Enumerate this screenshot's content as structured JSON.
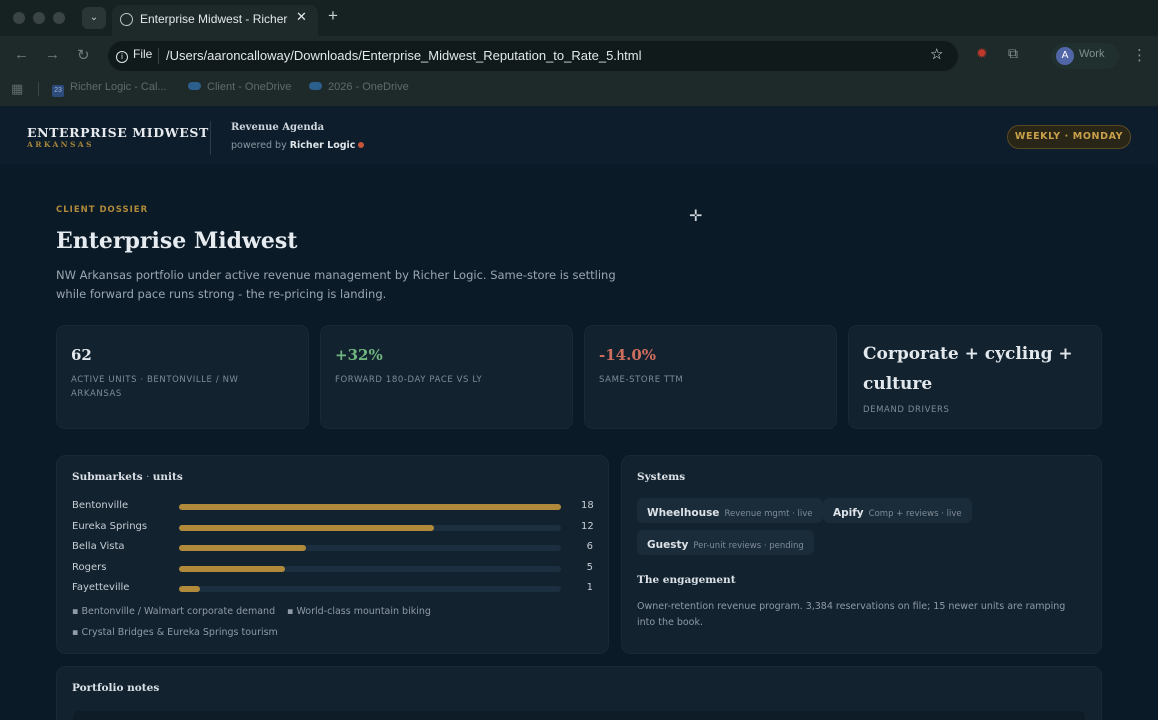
{
  "browser": {
    "tab_title": "Enterprise Midwest - Richer Logic",
    "url_scheme": "File",
    "url": "/Users/aaroncalloway/Downloads/Enterprise_Midwest_Reputation_to_Rate_5.html",
    "profile_initial": "A",
    "profile_label": "Work",
    "bookmarks": [
      {
        "label": "Richer Logic - Cal...",
        "icon": "calendar-icon",
        "icon_text": "23"
      },
      {
        "label": "Client - OneDrive",
        "icon": "onedrive-icon"
      },
      {
        "label": "2026 - OneDrive",
        "icon": "onedrive-icon"
      }
    ]
  },
  "header": {
    "brand_title": "ENTERPRISE MIDWEST",
    "brand_sub": "ARKANSAS",
    "agenda_title": "Revenue Agenda",
    "powered_prefix": "powered by",
    "powered_brand": "Richer Logic",
    "cadence": "WEEKLY · MONDAY"
  },
  "hero": {
    "eyebrow": "CLIENT DOSSIER",
    "title": "Enterprise Midwest",
    "lead": "NW Arkansas portfolio under active revenue management by Richer Logic. Same-store is settling while forward pace runs strong - the re-pricing is landing."
  },
  "stats": [
    {
      "value": "62",
      "label": "ACTIVE UNITS · BENTONVILLE / NW ARKANSAS",
      "tone": "neutral"
    },
    {
      "value": "+32%",
      "label": "FORWARD 180-DAY PACE VS LY",
      "tone": "positive"
    },
    {
      "value": "-14.0%",
      "label": "SAME-STORE TTM",
      "tone": "negative"
    },
    {
      "value": "Corporate + cycling + culture",
      "label": "DEMAND DRIVERS",
      "tone": "neutral"
    }
  ],
  "submarkets": {
    "title": "Submarkets",
    "title_suffix": "units",
    "max": 18,
    "rows": [
      {
        "name": "Bentonville",
        "units": 18
      },
      {
        "name": "Eureka Springs",
        "units": 12
      },
      {
        "name": "Bella Vista",
        "units": 6
      },
      {
        "name": "Rogers",
        "units": 5
      },
      {
        "name": "Fayetteville",
        "units": 1
      }
    ],
    "drivers": [
      "▪ Bentonville / Walmart corporate demand",
      "▪ World-class mountain biking",
      "▪ Crystal Bridges & Eureka Springs tourism"
    ]
  },
  "systems": {
    "title": "Systems",
    "items": [
      {
        "name": "Wheelhouse",
        "desc": "Revenue mgmt · live"
      },
      {
        "name": "Apify",
        "desc": "Comp + reviews · live"
      },
      {
        "name": "Guesty",
        "desc": "Per-unit reviews · pending"
      }
    ],
    "engagement_title": "The engagement",
    "engagement_text": "Owner-retention revenue program. 3,384 reservations on file; 15 newer units are ramping into the book."
  },
  "notes": {
    "title": "Portfolio notes"
  },
  "colors": {
    "accent_gold": "#b08a3a",
    "positive": "#6fb57e",
    "negative": "#cf6d5e",
    "background": "#0b1a27"
  }
}
